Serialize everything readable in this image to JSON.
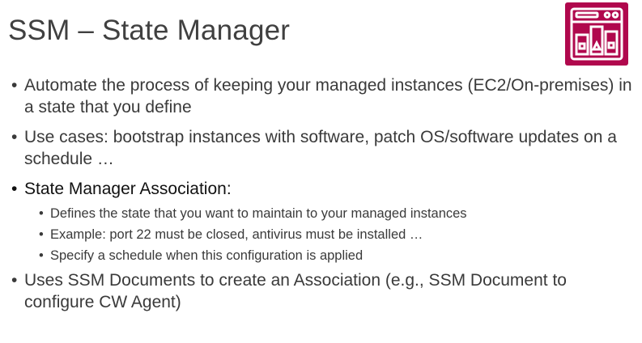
{
  "slide": {
    "title": "SSM – State Manager",
    "icon": "aws-systems-manager-state-manager-icon",
    "accent_color": "#b0084d",
    "bullets": [
      {
        "text": "Automate the process of keeping your managed instances (EC2/On-premises) in a state that you define"
      },
      {
        "text": "Use cases: bootstrap instances with software, patch OS/software updates on a schedule …"
      },
      {
        "text": "State Manager Association:",
        "sub": [
          "Defines the state that you want to maintain to your managed instances",
          "Example: port 22 must be closed, antivirus must be installed …",
          "Specify a schedule when this configuration is applied"
        ]
      },
      {
        "text": "Uses SSM Documents to create an Association (e.g., SSM Document to configure CW Agent)"
      }
    ]
  }
}
